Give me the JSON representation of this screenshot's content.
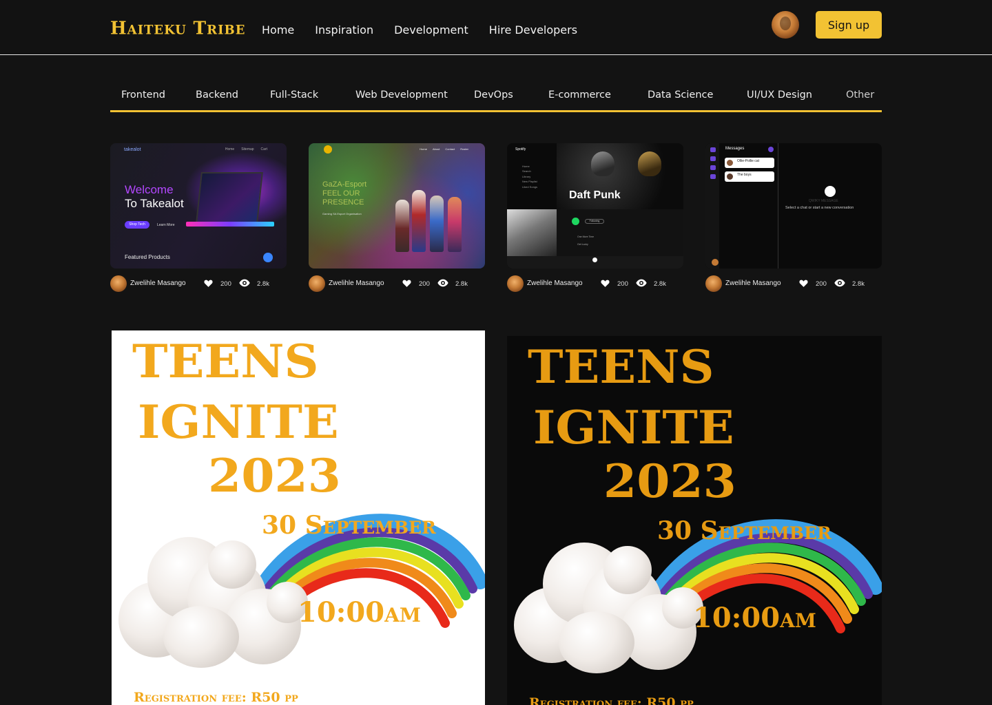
{
  "header": {
    "logo": "Haiteku Tribe",
    "nav": [
      "Home",
      "Inspiration",
      "Development",
      "Hire Developers"
    ],
    "signup_label": "Sign up"
  },
  "categories": [
    "Frontend",
    "Backend",
    "Full-Stack",
    "Web Development",
    "DevOps",
    "E-commerce",
    "Data Science",
    "UI/UX Design",
    "Other"
  ],
  "cards": [
    {
      "author": "Zwelihle Masango",
      "likes": "200",
      "views": "2.8k",
      "thumb": {
        "brand": "takealot",
        "nav": [
          "Home",
          "Sitemap",
          "Cart"
        ],
        "heading1": "Welcome",
        "heading2": "To Takealot",
        "button": "Shop Tech",
        "link": "Learn More",
        "footer": "Featured Products"
      }
    },
    {
      "author": "Zwelihle Masango",
      "likes": "200",
      "views": "2.8k",
      "thumb": {
        "nav": [
          "Home",
          "About",
          "Contact",
          "Roster"
        ],
        "heading": "GaZA-Esport FEEL OUR PRESENCE",
        "sub": "Gaming SA Esport Organisation"
      }
    },
    {
      "author": "Zwelihle Masango",
      "likes": "200",
      "views": "2.8k",
      "thumb": {
        "brand": "Spotify",
        "menu": [
          "Home",
          "Search",
          "Library",
          "New Playlist",
          "Liked Songs"
        ],
        "artist": "Daft Punk",
        "follow": "Following",
        "tracks": [
          "One More Time",
          "Get Lucky"
        ]
      }
    },
    {
      "author": "Zwelihle Masango",
      "likes": "200",
      "views": "2.8k",
      "thumb": {
        "title": "Messages",
        "chats": [
          "Ollie-Pollie cat",
          "The boys"
        ],
        "empty_title": "QWIKY MESSAGE",
        "empty_text": "Select a chat or start a new conversation"
      }
    }
  ],
  "posters": [
    {
      "line1": "TEENS",
      "line2": "IGNITE",
      "line3": "2023",
      "date": "30 September",
      "time": "10:00am",
      "fee": "Registration fee: R50 pp"
    },
    {
      "line1": "TEENS",
      "line2": "IGNITE",
      "line3": "2023",
      "date": "30 September",
      "time": "10:00am",
      "fee": "Registration fee: R50 pp"
    }
  ],
  "colors": {
    "accent": "#f2c233",
    "background": "#131313",
    "poster_text": "#f2a81d"
  },
  "icons": {
    "like": "heart-icon",
    "views": "eye-icon"
  }
}
